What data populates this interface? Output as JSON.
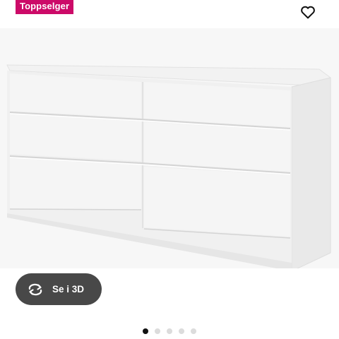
{
  "badge": {
    "label": "Toppselger",
    "color": "#cc0a68"
  },
  "favorite": {
    "icon": "heart-outline-icon"
  },
  "product_image": {
    "subject": "white six-drawer chest of drawers"
  },
  "view_3d": {
    "label": "Se i 3D",
    "icon": "rotate-arrows-icon"
  },
  "carousel": {
    "count": 5,
    "active_index": 0
  }
}
